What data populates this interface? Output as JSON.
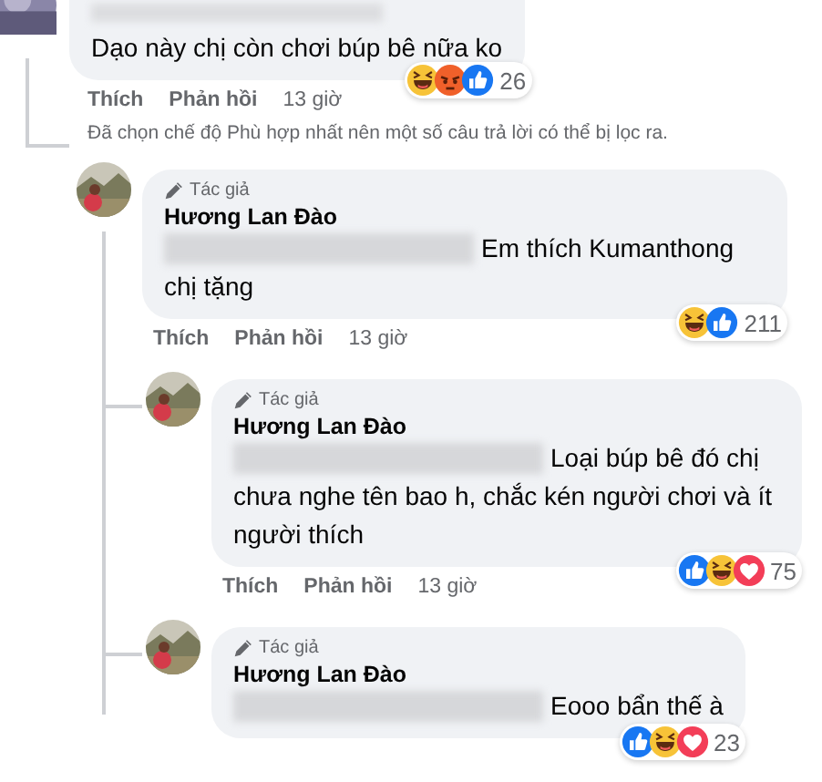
{
  "comment": {
    "text": "Dạo này chị còn chơi búp bê nữa ko",
    "reactions": [
      {
        "kind": "haha"
      },
      {
        "kind": "angry"
      },
      {
        "kind": "like"
      }
    ],
    "reaction_count": "26",
    "actions": [
      "Thích",
      "Phản hồi",
      "13 giờ"
    ]
  },
  "filter_notice": "Đã chọn chế độ Phù hợp nhất nên một số câu trả lời có thể bị lọc ra.",
  "replies": [
    {
      "badge": "Tác giả",
      "author": "Hương Lan Đào",
      "text": "Em thích Kumanthong chị tặng",
      "reactions": [
        {
          "kind": "haha"
        },
        {
          "kind": "like"
        }
      ],
      "reaction_count": "211",
      "actions": [
        "Thích",
        "Phản hồi",
        "13 giờ"
      ],
      "children": [
        {
          "badge": "Tác giả",
          "author": "Hương Lan Đào",
          "text": "Loại búp bê đó chị chưa nghe tên bao h, chắc kén người chơi và ít người thích",
          "reactions": [
            {
              "kind": "like"
            },
            {
              "kind": "haha"
            },
            {
              "kind": "love"
            }
          ],
          "reaction_count": "75",
          "actions": [
            "Thích",
            "Phản hồi",
            "13 giờ"
          ]
        },
        {
          "badge": "Tác giả",
          "author": "Hương Lan Đào",
          "text": "Eooo bẩn thế à",
          "reactions": [
            {
              "kind": "like"
            },
            {
              "kind": "haha"
            },
            {
              "kind": "love"
            }
          ],
          "reaction_count": "23"
        }
      ]
    }
  ]
}
